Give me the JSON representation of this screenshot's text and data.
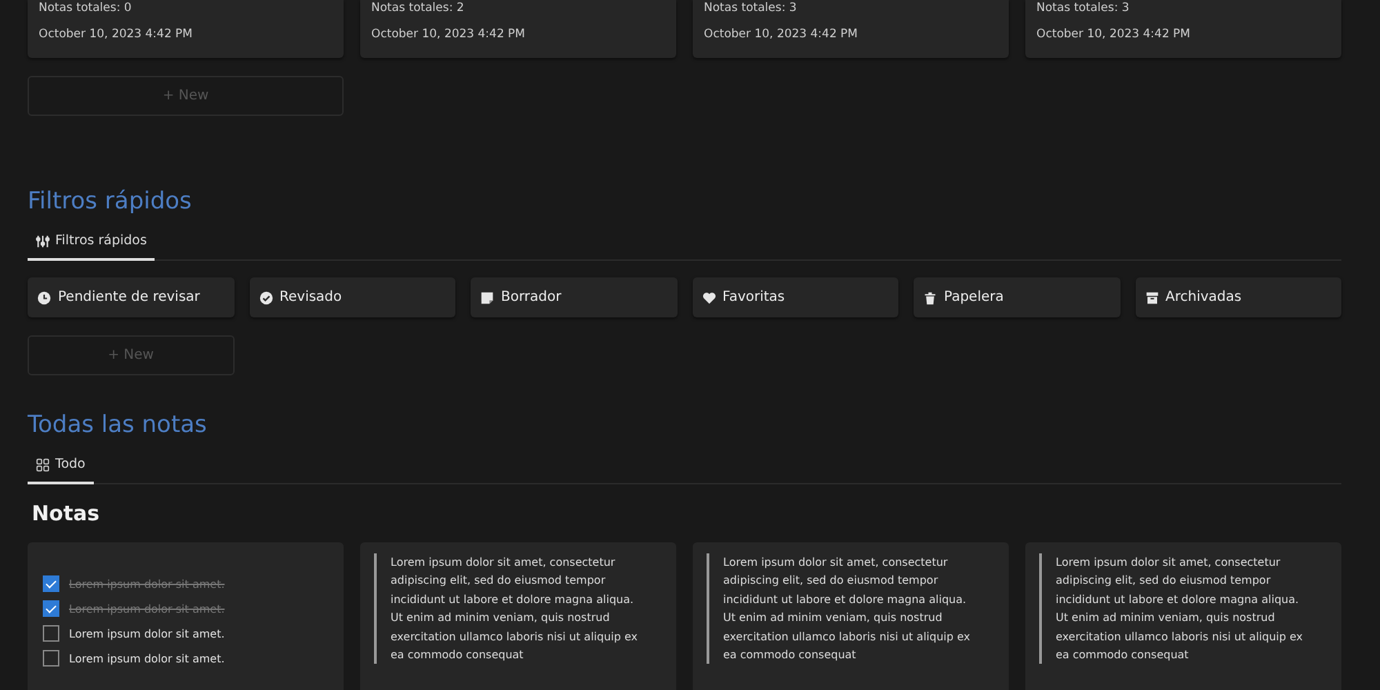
{
  "collections": [
    {
      "count": "Notas totales: 0",
      "date": "October 10, 2023 4:42 PM"
    },
    {
      "count": "Notas totales: 2",
      "date": "October 10, 2023 4:42 PM"
    },
    {
      "count": "Notas totales: 3",
      "date": "October 10, 2023 4:42 PM"
    },
    {
      "count": "Notas totales: 3",
      "date": "October 10, 2023 4:42 PM"
    }
  ],
  "collections_new": "+ New",
  "quick_filters": {
    "title": "Filtros rápidos",
    "tabs": [
      {
        "label": "Filtros rápidos",
        "selected": true
      }
    ],
    "items": [
      {
        "kind": "clock",
        "label": "Pendiente de revisar"
      },
      {
        "kind": "check",
        "label": "Revisado"
      },
      {
        "kind": "note",
        "label": "Borrador"
      },
      {
        "kind": "heart",
        "label": "Favoritas"
      },
      {
        "kind": "trash",
        "label": "Papelera"
      },
      {
        "kind": "archive",
        "label": "Archivadas"
      }
    ],
    "new": "+ New"
  },
  "all_notes": {
    "title": "Todas las notas",
    "tabs": [
      {
        "label": "Todo",
        "selected": true
      }
    ],
    "heading": "Notas",
    "notes": [
      {
        "kind": "checklist",
        "items": [
          {
            "text": "Lorem ipsum dolor sit amet.",
            "checked": true
          },
          {
            "text": "Lorem ipsum dolor sit amet.",
            "checked": true
          },
          {
            "text": "Lorem ipsum dolor sit amet.",
            "checked": false
          },
          {
            "text": "Lorem ipsum dolor sit amet.",
            "checked": false
          }
        ]
      },
      {
        "kind": "quote",
        "text": "Lorem ipsum dolor sit amet, consectetur adipiscing elit, sed do eiusmod tempor incididunt ut labore et dolore magna aliqua. Ut enim ad minim veniam, quis nostrud exercitation ullamco laboris nisi ut aliquip ex ea commodo consequat"
      },
      {
        "kind": "quote",
        "text": "Lorem ipsum dolor sit amet, consectetur adipiscing elit, sed do eiusmod tempor incididunt ut labore et dolore magna aliqua. Ut enim ad minim veniam, quis nostrud exercitation ullamco laboris nisi ut aliquip ex ea commodo consequat"
      },
      {
        "kind": "quote",
        "text": "Lorem ipsum dolor sit amet, consectetur adipiscing elit, sed do eiusmod tempor incididunt ut labore et dolore magna aliqua. Ut enim ad minim veniam, quis nostrud exercitation ullamco laboris nisi ut aliquip ex ea commodo consequat"
      }
    ]
  }
}
